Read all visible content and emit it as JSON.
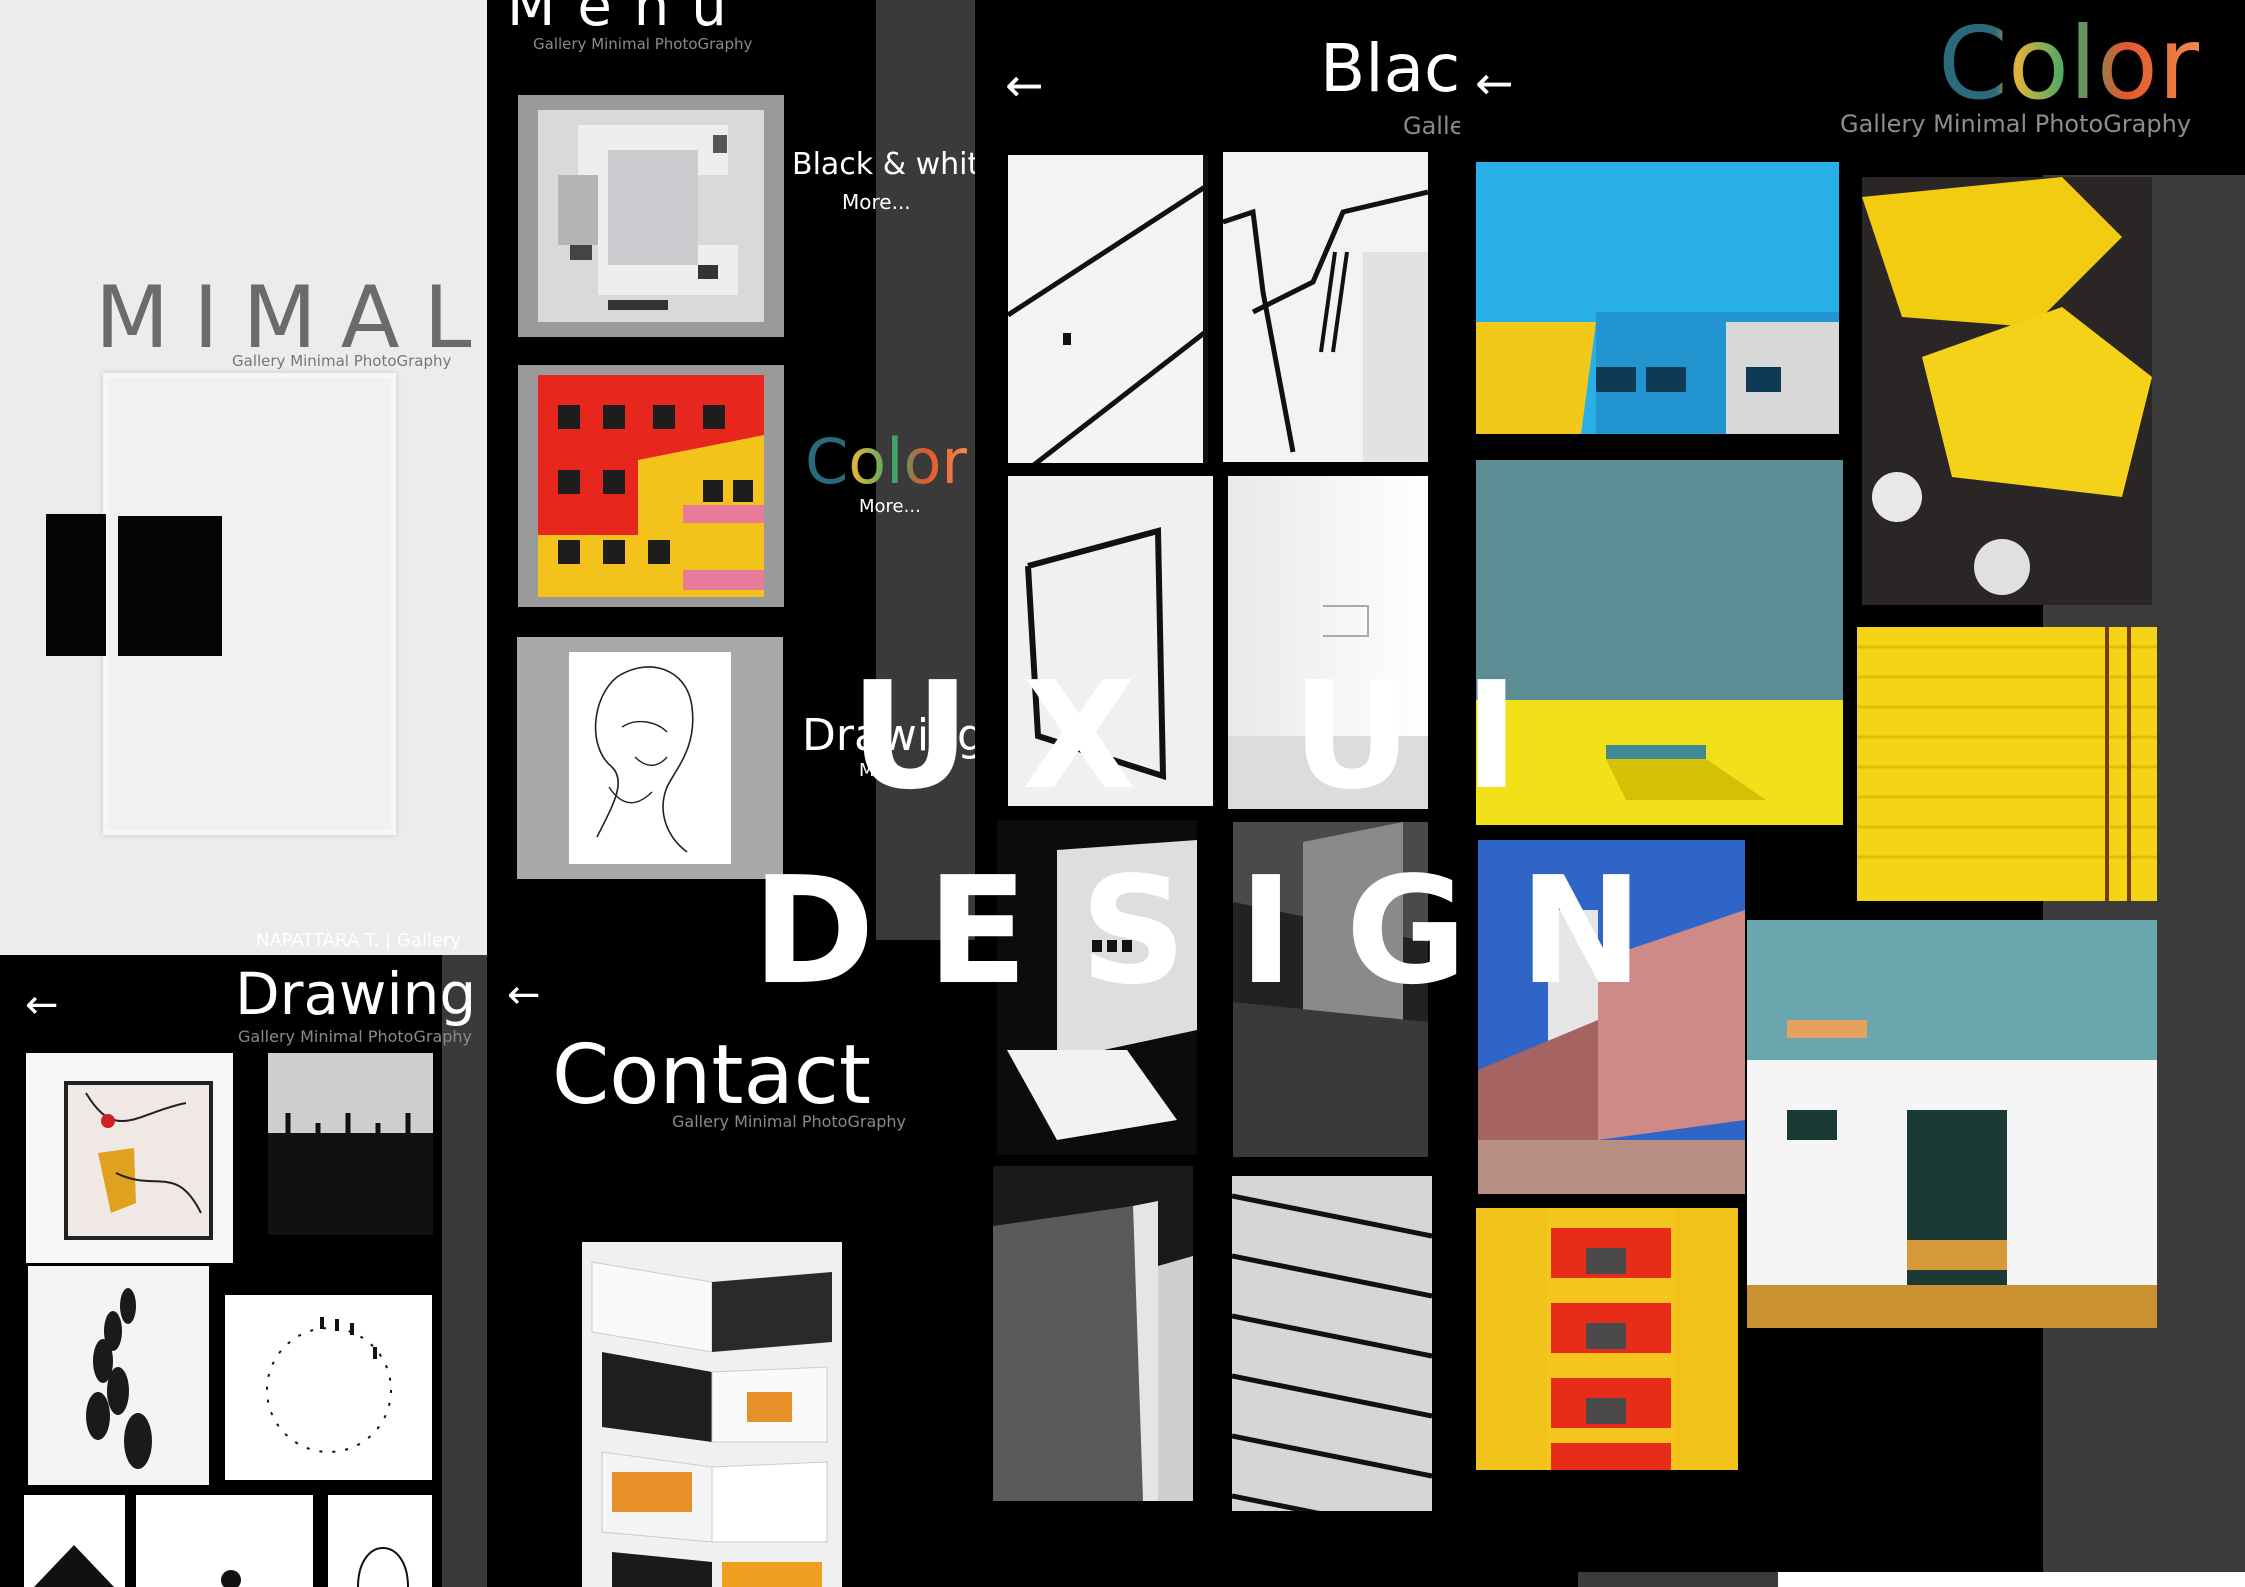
{
  "splash": {
    "title": "MIMAL",
    "subtitle": "Gallery Minimal PhotoGraphy",
    "footer": "NAPATTARA T. | Gallery"
  },
  "menu": {
    "title": "Menu",
    "subtitle": "Gallery Minimal PhotoGraphy",
    "items": [
      {
        "label": "Black & white",
        "more": "More..."
      },
      {
        "label": "Color",
        "more": "More..."
      },
      {
        "label": "Drawing",
        "more": "More..."
      }
    ]
  },
  "blackwhite": {
    "back_icon": "arrow-left-icon",
    "title": "Black",
    "subtitle": "Galle"
  },
  "color": {
    "back_icon": "arrow-left-icon",
    "title": "Color",
    "subtitle": "Gallery Minimal PhotoGraphy",
    "title_colors": [
      "#2a6a7a",
      "#e2b43a",
      "#3aa86a",
      "#e4572e",
      "#f28a4a"
    ]
  },
  "drawing": {
    "back_icon": "arrow-left-icon",
    "title": "Drawing",
    "subtitle": "Gallery Minimal PhotoGraphy"
  },
  "contact": {
    "back_icon": "arrow-left-icon",
    "title": "Contact",
    "subtitle": "Gallery Minimal PhotoGraphy"
  },
  "overlay": {
    "line1": "UX UI",
    "line2": "DESIGN"
  }
}
